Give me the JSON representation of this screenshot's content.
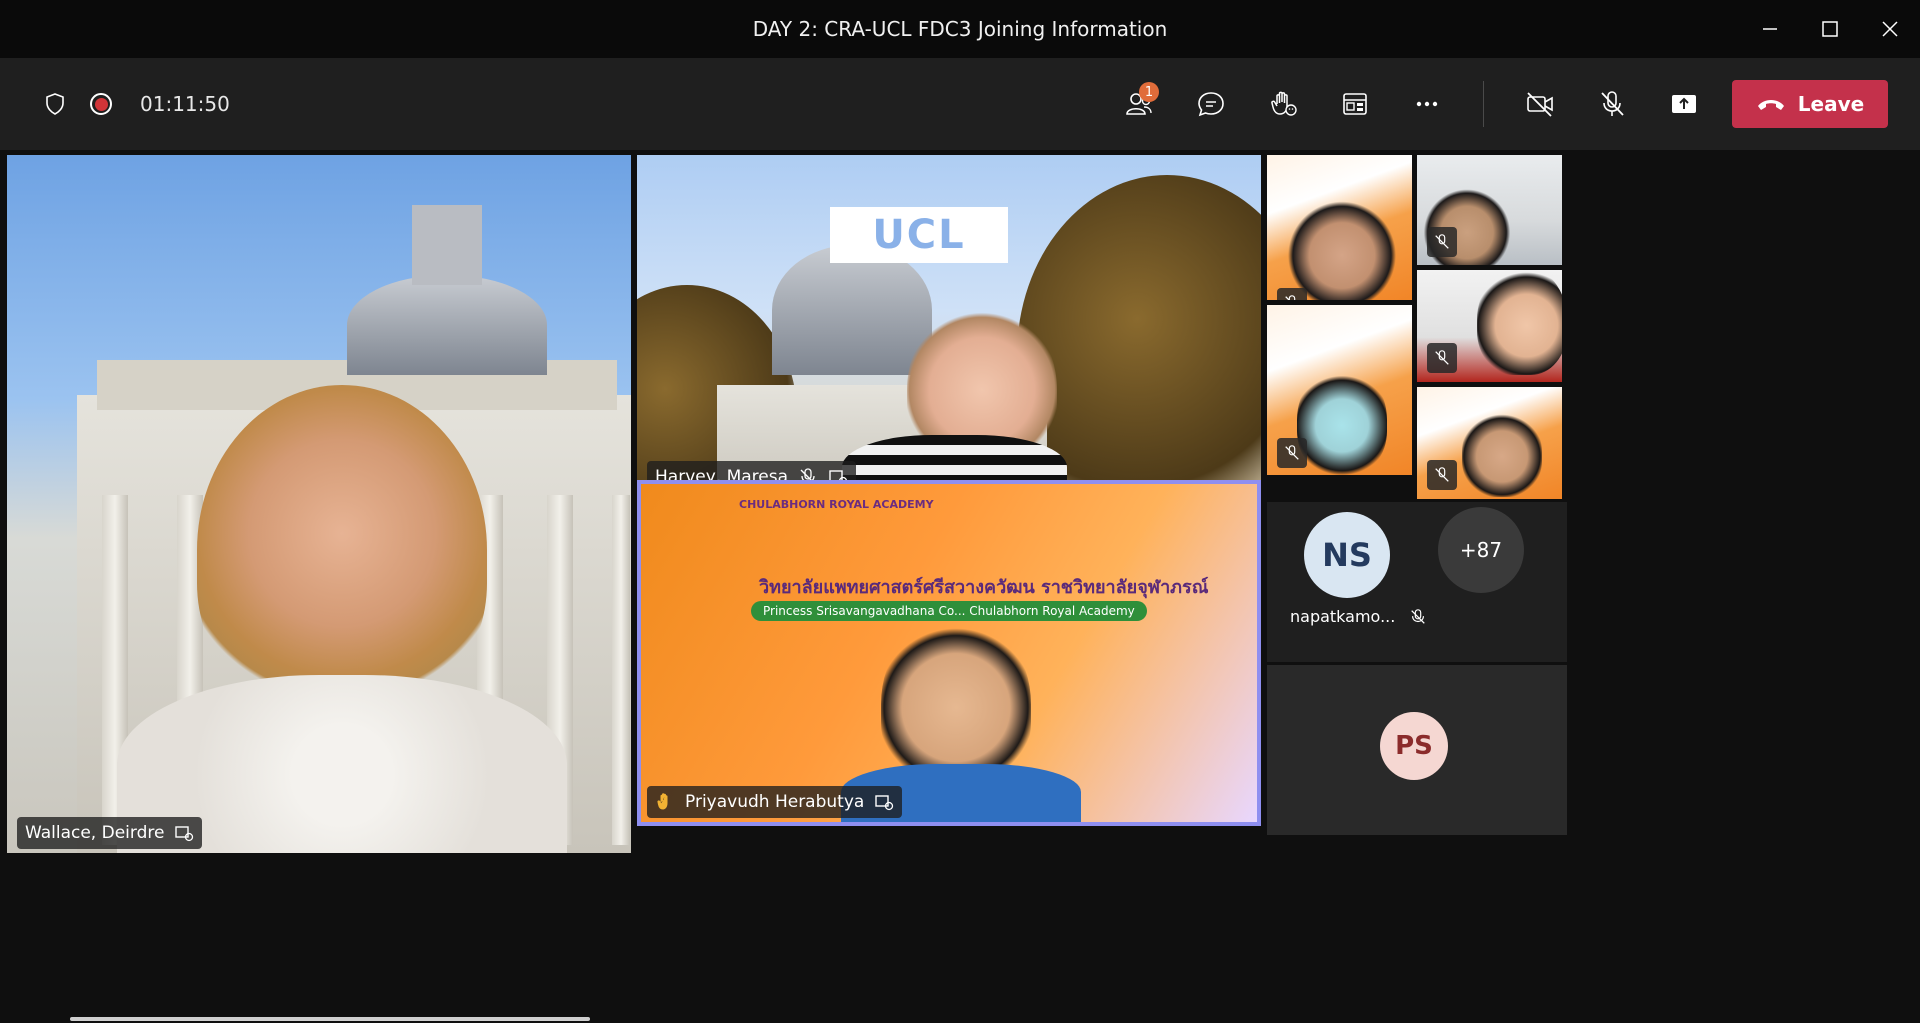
{
  "window": {
    "title": "DAY 2: CRA-UCL FDC3 Joining Information",
    "controls": [
      "minimize",
      "maximize",
      "close"
    ]
  },
  "toolbar": {
    "timer": "01:11:50",
    "participants_badge": "1",
    "leave_label": "Leave",
    "icons": [
      "shield-icon",
      "record-icon",
      "participants-icon",
      "chat-icon",
      "raise-hand-icon",
      "rooms-icon",
      "more-icon",
      "camera-off-icon",
      "mic-off-icon",
      "share-icon"
    ]
  },
  "participants": {
    "main_left": {
      "name": "Wallace, Deirdre"
    },
    "main_top": {
      "name": "Harvey, Maresa"
    },
    "main_bottom": {
      "name": "Priyavudh Herabutya"
    },
    "napat": {
      "initials": "NS",
      "name": "napatkamo..."
    },
    "overflow": {
      "label": "+87"
    },
    "ps": {
      "initials": "PS"
    }
  },
  "banner": {
    "thai_title": "วิทยาลัยแพทยศาสตร์ศรีสวางควัฒน ราชวิทยาลัยจุฬาภรณ์",
    "pill_text": "Princess Srisavangavadhana Co... Chulabhorn Royal Academy",
    "academy": "CHULABHORN ROYAL ACADEMY",
    "logo_text": "UCL"
  },
  "colors": {
    "leave": "#c4314b",
    "active_border": "#8f8ff0",
    "badge": "#e06c3a"
  }
}
